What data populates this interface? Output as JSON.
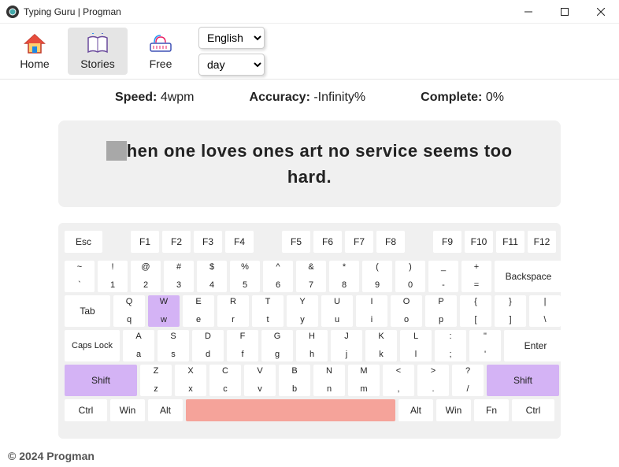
{
  "window": {
    "title": "Typing Guru | Progman"
  },
  "nav": {
    "home": "Home",
    "stories": "Stories",
    "free": "Free"
  },
  "selects": {
    "language": "English",
    "theme": "day"
  },
  "stats": {
    "speed_label": "Speed:",
    "speed_value": "4wpm",
    "accuracy_label": "Accuracy:",
    "accuracy_value": "-Infinity%",
    "complete_label": "Complete:",
    "complete_value": "0%"
  },
  "typing": {
    "cursor": "W",
    "rest": "hen one loves ones art no service seems too hard."
  },
  "keys": {
    "esc": "Esc",
    "f1": "F1",
    "f2": "F2",
    "f3": "F3",
    "f4": "F4",
    "f5": "F5",
    "f6": "F6",
    "f7": "F7",
    "f8": "F8",
    "f9": "F9",
    "f10": "F10",
    "f11": "F11",
    "f12": "F12",
    "r1": [
      {
        "t": "~",
        "b": "`"
      },
      {
        "t": "!",
        "b": "1"
      },
      {
        "t": "@",
        "b": "2"
      },
      {
        "t": "#",
        "b": "3"
      },
      {
        "t": "$",
        "b": "4"
      },
      {
        "t": "%",
        "b": "5"
      },
      {
        "t": "^",
        "b": "6"
      },
      {
        "t": "&",
        "b": "7"
      },
      {
        "t": "*",
        "b": "8"
      },
      {
        "t": "(",
        "b": "9"
      },
      {
        "t": ")",
        "b": "0"
      },
      {
        "t": "_",
        "b": "-"
      },
      {
        "t": "+",
        "b": "="
      }
    ],
    "backspace": "Backspace",
    "tab": "Tab",
    "r2": [
      {
        "t": "Q",
        "b": "q"
      },
      {
        "t": "W",
        "b": "w"
      },
      {
        "t": "E",
        "b": "e"
      },
      {
        "t": "R",
        "b": "r"
      },
      {
        "t": "T",
        "b": "t"
      },
      {
        "t": "Y",
        "b": "y"
      },
      {
        "t": "U",
        "b": "u"
      },
      {
        "t": "I",
        "b": "i"
      },
      {
        "t": "O",
        "b": "o"
      },
      {
        "t": "P",
        "b": "p"
      },
      {
        "t": "{",
        "b": "["
      },
      {
        "t": "}",
        "b": "]"
      },
      {
        "t": "|",
        "b": "\\"
      }
    ],
    "caps": "Caps Lock",
    "r3": [
      {
        "t": "A",
        "b": "a"
      },
      {
        "t": "S",
        "b": "s"
      },
      {
        "t": "D",
        "b": "d"
      },
      {
        "t": "F",
        "b": "f"
      },
      {
        "t": "G",
        "b": "g"
      },
      {
        "t": "H",
        "b": "h"
      },
      {
        "t": "J",
        "b": "j"
      },
      {
        "t": "K",
        "b": "k"
      },
      {
        "t": "L",
        "b": "l"
      },
      {
        "t": ":",
        "b": ";"
      },
      {
        "t": "\"",
        "b": "'"
      }
    ],
    "enter": "Enter",
    "shift": "Shift",
    "r4": [
      {
        "t": "Z",
        "b": "z"
      },
      {
        "t": "X",
        "b": "x"
      },
      {
        "t": "C",
        "b": "c"
      },
      {
        "t": "V",
        "b": "v"
      },
      {
        "t": "B",
        "b": "b"
      },
      {
        "t": "N",
        "b": "n"
      },
      {
        "t": "M",
        "b": "m"
      },
      {
        "t": "<",
        "b": ","
      },
      {
        "t": ">",
        "b": "."
      },
      {
        "t": "?",
        "b": "/"
      }
    ],
    "ctrl": "Ctrl",
    "win": "Win",
    "alt": "Alt",
    "fn": "Fn"
  },
  "footer": "© 2024 Progman"
}
